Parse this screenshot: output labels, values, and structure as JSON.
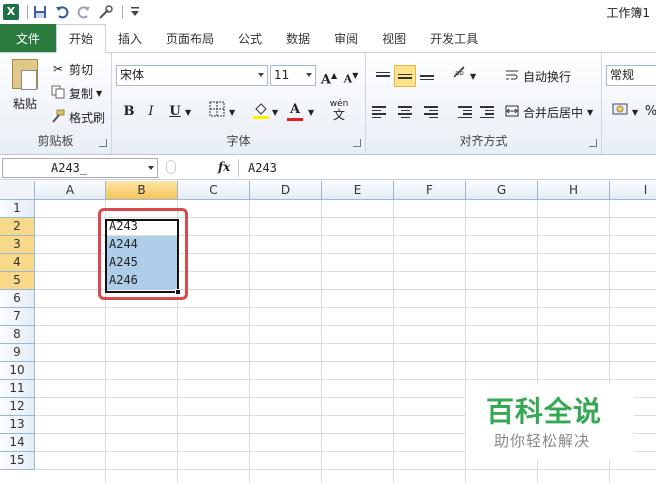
{
  "app": {
    "window_title": "工作簿1"
  },
  "qat": {
    "logo": "X",
    "icons": [
      "excel-logo",
      "save-icon",
      "undo-icon",
      "redo-icon",
      "customize-icon"
    ]
  },
  "tabs": [
    {
      "label": "文件"
    },
    {
      "label": "开始"
    },
    {
      "label": "插入"
    },
    {
      "label": "页面布局"
    },
    {
      "label": "公式"
    },
    {
      "label": "数据"
    },
    {
      "label": "审阅"
    },
    {
      "label": "视图"
    },
    {
      "label": "开发工具"
    }
  ],
  "ribbon": {
    "clipboard": {
      "paste": "粘贴",
      "cut": "剪切",
      "copy": "复制",
      "format_painter": "格式刷",
      "label": "剪贴板"
    },
    "font": {
      "name": "宋体",
      "size": "11",
      "label": "字体",
      "bold": "B",
      "italic": "I",
      "underline": "U",
      "grow": "A",
      "shrink": "A",
      "font_color": "A",
      "phonetic": "wén 文",
      "phonetic_top": "wén",
      "phonetic_bottom": "文"
    },
    "alignment": {
      "wrap": "自动换行",
      "merge": "合并后居中",
      "label": "对齐方式"
    },
    "number": {
      "format": "常规",
      "percent": "%"
    }
  },
  "formula_bar": {
    "name_box": "A243_",
    "fx": "fx",
    "value": "A243"
  },
  "grid": {
    "columns": [
      "A",
      "B",
      "C",
      "D",
      "E",
      "F",
      "G",
      "H",
      "I"
    ],
    "rows": [
      "1",
      "2",
      "3",
      "4",
      "5",
      "6",
      "7",
      "8",
      "9",
      "10",
      "11",
      "12",
      "13",
      "14",
      "15"
    ],
    "cells": {
      "B2": "A243",
      "B3": "A244",
      "B4": "A245",
      "B5": "A246"
    }
  },
  "watermark": {
    "title": "百科全说",
    "subtitle": "助你轻松解决"
  },
  "colors": {
    "file_tab": "#2b7a3e",
    "selection_fill": "#aecde9",
    "annotation_red": "#d9494f",
    "watermark_green": "#34a853"
  }
}
